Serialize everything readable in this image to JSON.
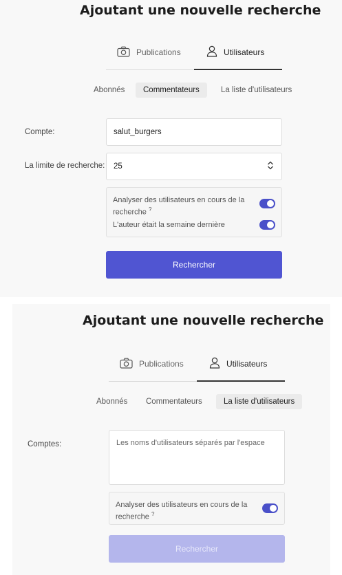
{
  "panel1": {
    "title": "Ajoutant une nouvelle recherche",
    "tabs": [
      {
        "label": "Publications",
        "icon": "camera-icon",
        "active": false
      },
      {
        "label": "Utilisateurs",
        "icon": "user-icon",
        "active": true
      }
    ],
    "subtabs": [
      {
        "label": "Abonnés",
        "selected": false
      },
      {
        "label": "Commentateurs",
        "selected": true
      },
      {
        "label": "La liste d'utilisateurs",
        "selected": false
      }
    ],
    "account_label": "Compte:",
    "account_value": "salut_burgers",
    "limit_label": "La limite de recherche:",
    "limit_value": "25",
    "options": [
      {
        "label": "Analyser des utilisateurs en cours de la recherche",
        "help": "?",
        "enabled": true
      },
      {
        "label": "L'auteur était  la semaine dernière",
        "enabled": true
      }
    ],
    "submit_label": "Rechercher"
  },
  "panel2": {
    "title": "Ajoutant une nouvelle recherche",
    "tabs": [
      {
        "label": "Publications",
        "icon": "camera-icon",
        "active": false
      },
      {
        "label": "Utilisateurs",
        "icon": "user-icon",
        "active": true
      }
    ],
    "subtabs": [
      {
        "label": "Abonnés",
        "selected": false
      },
      {
        "label": "Commentateurs",
        "selected": false
      },
      {
        "label": "La liste d'utilisateurs",
        "selected": true
      }
    ],
    "accounts_label": "Comptes:",
    "accounts_placeholder": "Les noms d'utilisateurs séparés par l'espace",
    "accounts_value": "",
    "options": [
      {
        "label": "Analyser des utilisateurs en cours de la recherche",
        "help": "?",
        "enabled": true
      }
    ],
    "submit_label": "Rechercher",
    "submit_disabled": true
  },
  "colors": {
    "accent": "#5055d2",
    "accent_disabled": "#b4b6ec",
    "toggle_on": "#4a50c9",
    "panel_bg": "#f8f8f8"
  }
}
